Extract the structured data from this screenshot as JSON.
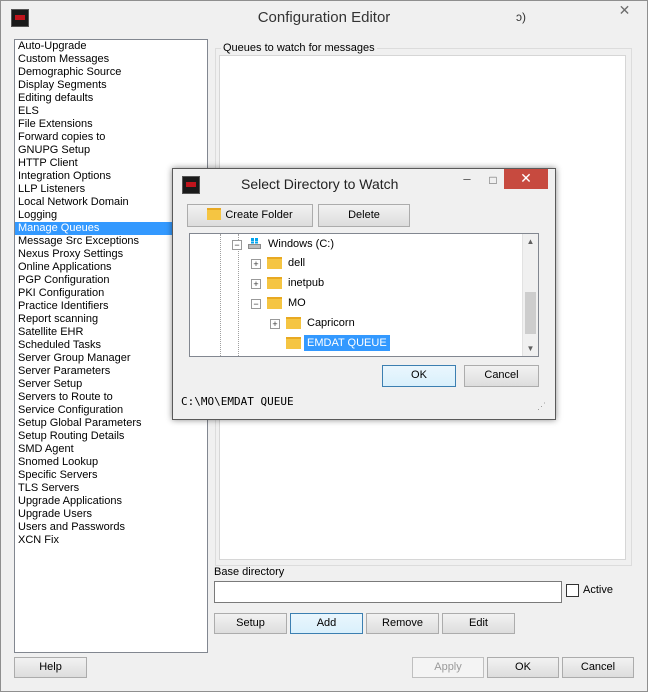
{
  "window": {
    "title": "Configuration Editor",
    "title_extra": "ɔ)",
    "close_glyph": "✕"
  },
  "sidebar": {
    "items": [
      "Auto-Upgrade",
      "Custom Messages",
      "Demographic Source",
      "Display Segments",
      "Editing defaults",
      "ELS",
      "File Extensions",
      "Forward copies to",
      "GNUPG Setup",
      "HTTP Client",
      "Integration Options",
      "LLP Listeners",
      "Local Network Domain",
      "Logging",
      "Manage Queues",
      "Message Src Exceptions",
      "Nexus Proxy Settings",
      "Online Applications",
      "PGP Configuration",
      "PKI Configuration",
      "Practice Identifiers",
      "Report scanning",
      "Satellite EHR",
      "Scheduled Tasks",
      "Server Group Manager",
      "Server Parameters",
      "Server Setup",
      "Servers to Route to",
      "Service Configuration",
      "Setup Global Parameters",
      "Setup Routing Details",
      "SMD Agent",
      "Snomed Lookup",
      "Specific Servers",
      "TLS Servers",
      "Upgrade Applications",
      "Upgrade Users",
      "Users and Passwords",
      "XCN Fix"
    ],
    "selected": "Manage Queues"
  },
  "main": {
    "group_label": "Queues to watch for messages",
    "base_directory_label": "Base directory",
    "base_directory_value": "",
    "active_label": "Active",
    "active_checked": false,
    "buttons": {
      "setup": "Setup",
      "add": "Add",
      "remove": "Remove",
      "edit": "Edit"
    }
  },
  "footer": {
    "help": "Help",
    "apply": "Apply",
    "ok": "OK",
    "cancel": "Cancel"
  },
  "dialog": {
    "title": "Select Directory to Watch",
    "min_glyph": "–",
    "max_glyph": "□",
    "close_glyph": "✕",
    "create_folder_label": "Create Folder",
    "delete_label": "Delete",
    "tree": {
      "drive": "Windows (C:)",
      "items": [
        "dell",
        "inetpub",
        "MO",
        "Capricorn",
        "EMDAT QUEUE"
      ],
      "selected": "EMDAT QUEUE"
    },
    "ok_label": "OK",
    "cancel_label": "Cancel",
    "status_path": "C:\\MO\\EMDAT QUEUE"
  },
  "colors": {
    "selection": "#3399ff",
    "dialog_close": "#c74a3f",
    "folder": "#f5c542"
  }
}
